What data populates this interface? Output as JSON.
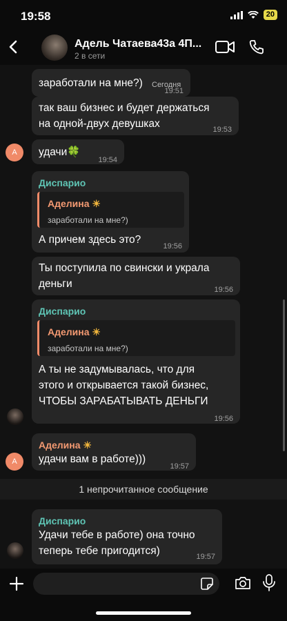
{
  "status_bar": {
    "time": "19:58",
    "battery": "20"
  },
  "header": {
    "name": "Адель Чатаева43а 4П...",
    "status": "2 в сети"
  },
  "date_separator": "Сегодня",
  "messages": [
    {
      "text": "заработали на мне?)",
      "time": "19:51"
    },
    {
      "lines": [
        "так ваш бизнес и будет держаться",
        "на одной-двух девушках"
      ],
      "time": "19:53"
    },
    {
      "avatar": "А",
      "text": "удачи",
      "emoji": "🍀",
      "time": "19:54"
    },
    {
      "sender": "Диспарио",
      "quote": {
        "name": "Аделина",
        "emoji": "☀",
        "text": "заработали на мне?)"
      },
      "text": "А причем здесь это?",
      "time": "19:56"
    },
    {
      "lines": [
        "Ты поступила по свински и украла",
        "деньги"
      ],
      "time": "19:56"
    },
    {
      "sender": "Диспарио",
      "quote": {
        "name": "Аделина",
        "emoji": "☀",
        "text": "заработали на мне?)"
      },
      "lines": [
        "А ты не задумывалась, что для",
        "этого и открывается такой бизнес,",
        "ЧТОБЫ ЗАРАБАТЫВАТЬ ДЕНЬГИ"
      ],
      "time": "19:56"
    },
    {
      "avatar": "А",
      "sender": "Аделина",
      "sender_emoji": "☀",
      "text": "удачи вам в работе)))",
      "time": "19:57"
    },
    {
      "sender": "Диспарио",
      "lines": [
        "Удачи тебе в работе) она точно",
        "теперь тебе пригодится)"
      ],
      "time": "19:57"
    }
  ],
  "unread": "1 непрочитанное сообщение",
  "composer": {
    "placeholder": ""
  },
  "icons": [
    "back-icon",
    "video-call-icon",
    "phone-icon",
    "plus-icon",
    "sticker-icon",
    "camera-icon",
    "microphone-icon"
  ]
}
